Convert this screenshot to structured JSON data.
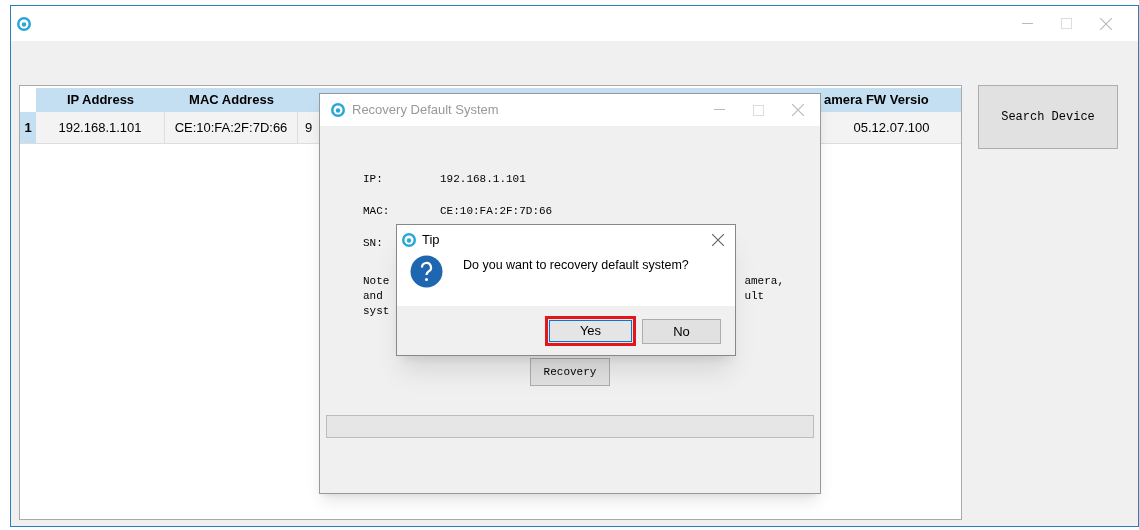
{
  "table": {
    "columns": [
      "IP Address",
      "MAC Address",
      "",
      "amera FW Versio"
    ],
    "rows": [
      {
        "index": "1",
        "cells": [
          "192.168.1.101",
          "CE:10:FA:2F:7D:66",
          "9",
          "05.12.07.100"
        ]
      }
    ]
  },
  "search_button": "Search Device",
  "recovery_dialog": {
    "title": "Recovery Default System",
    "fields": [
      {
        "label": "IP:",
        "value": "192.168.1.101"
      },
      {
        "label": "MAC:",
        "value": "CE:10:FA:2F:7D:66"
      },
      {
        "label": "SN:"
      }
    ],
    "note_left": [
      "Note",
      "and",
      "syst"
    ],
    "note_right": [
      "amera,",
      "ult"
    ],
    "button": "Recovery",
    "progress": {
      "level": 0
    }
  },
  "tip_dialog": {
    "title": "Tip",
    "message": "Do you want to recovery default system?",
    "buttons": [
      {
        "label": "Yes",
        "highlighted": true
      },
      {
        "label": "No",
        "highlighted": false
      }
    ]
  }
}
